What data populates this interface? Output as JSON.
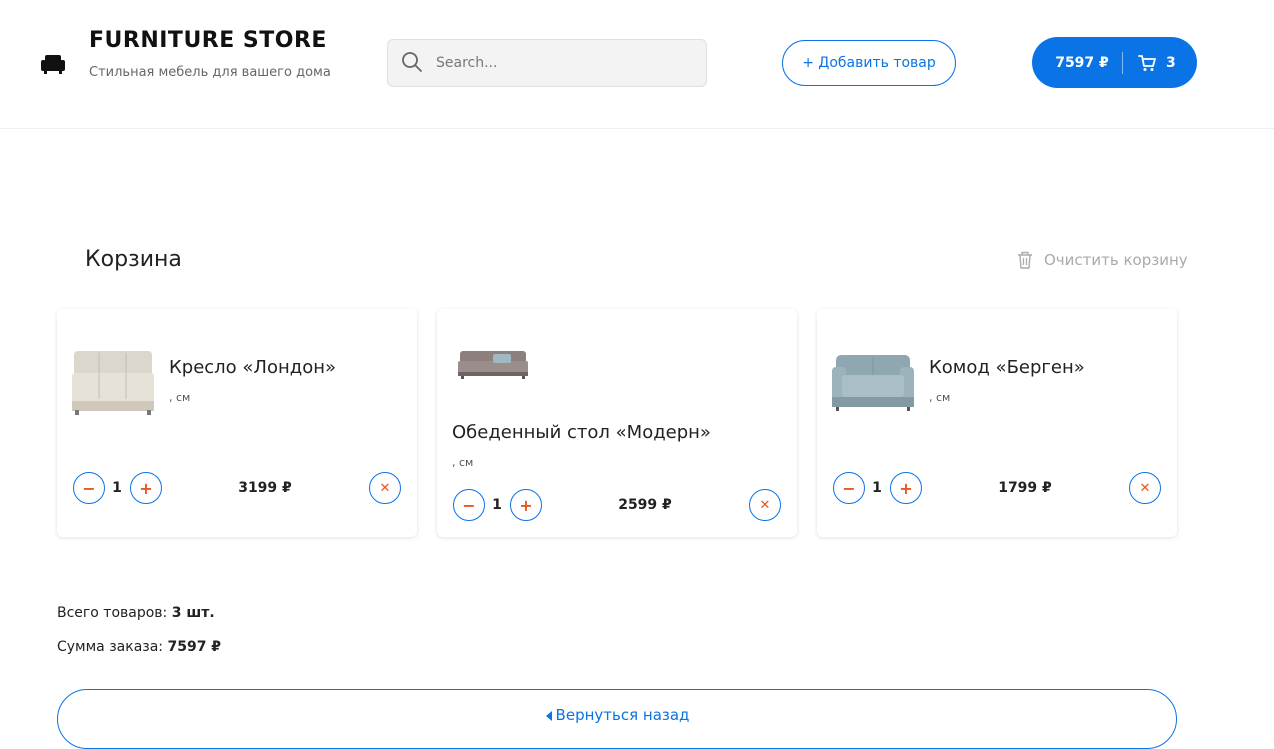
{
  "header": {
    "brand_title": "FURNITURE STORE",
    "brand_subtitle": "Стильная мебель для вашего дома",
    "search_placeholder": "Search...",
    "add_product_label": "+ Добавить товар",
    "cart_total": "7597 ₽",
    "cart_count": "3"
  },
  "cart": {
    "title": "Корзина",
    "clear_label": "Очистить корзину",
    "items": [
      {
        "name": "Кресло «Лондон»",
        "size": ", см",
        "quantity": "1",
        "price": "3199 ₽",
        "minus": "−",
        "plus": "+",
        "remove": "✕"
      },
      {
        "name": "Обеденный стол «Модерн»",
        "size": ", см",
        "quantity": "1",
        "price": "2599 ₽",
        "minus": "−",
        "plus": "+",
        "remove": "✕"
      },
      {
        "name": "Комод «Берген»",
        "size": ", см",
        "quantity": "1",
        "price": "1799 ₽",
        "minus": "−",
        "plus": "+",
        "remove": "✕"
      }
    ]
  },
  "summary": {
    "items_label": "Всего товаров: ",
    "items_value": "3 шт.",
    "sum_label": "Сумма заказа: ",
    "sum_value": "7597 ₽"
  },
  "back_label": "Вернуться назад",
  "colors": {
    "accent": "#0a74e6",
    "danger": "#e8561f"
  },
  "icons": [
    "armchair-icon",
    "search-icon",
    "cart-icon",
    "trash-icon",
    "arrow-left-icon"
  ]
}
